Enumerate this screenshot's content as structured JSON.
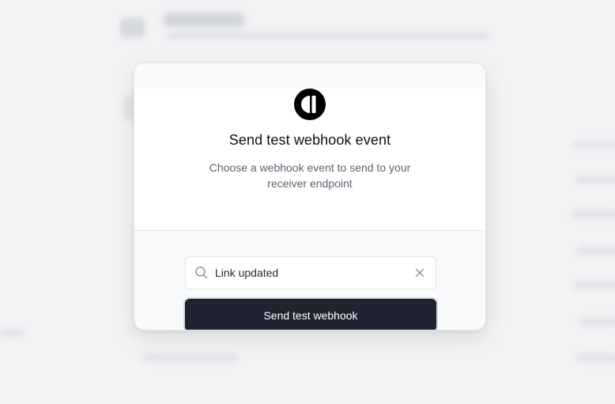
{
  "modal": {
    "title": "Send test webhook event",
    "description": "Choose a webhook event to send to your receiver endpoint",
    "logo_icon": "brand-logo-icon",
    "search": {
      "value": "Link updated",
      "placeholder": "",
      "search_icon": "search-icon",
      "clear_icon": "close-icon"
    },
    "send_button_label": "Send test webhook"
  },
  "colors": {
    "button_bg": "#1f2430",
    "page_bg": "#f2f3f5",
    "modal_bg": "#ffffff",
    "text_primary": "#111111",
    "text_secondary": "#5b6270"
  }
}
